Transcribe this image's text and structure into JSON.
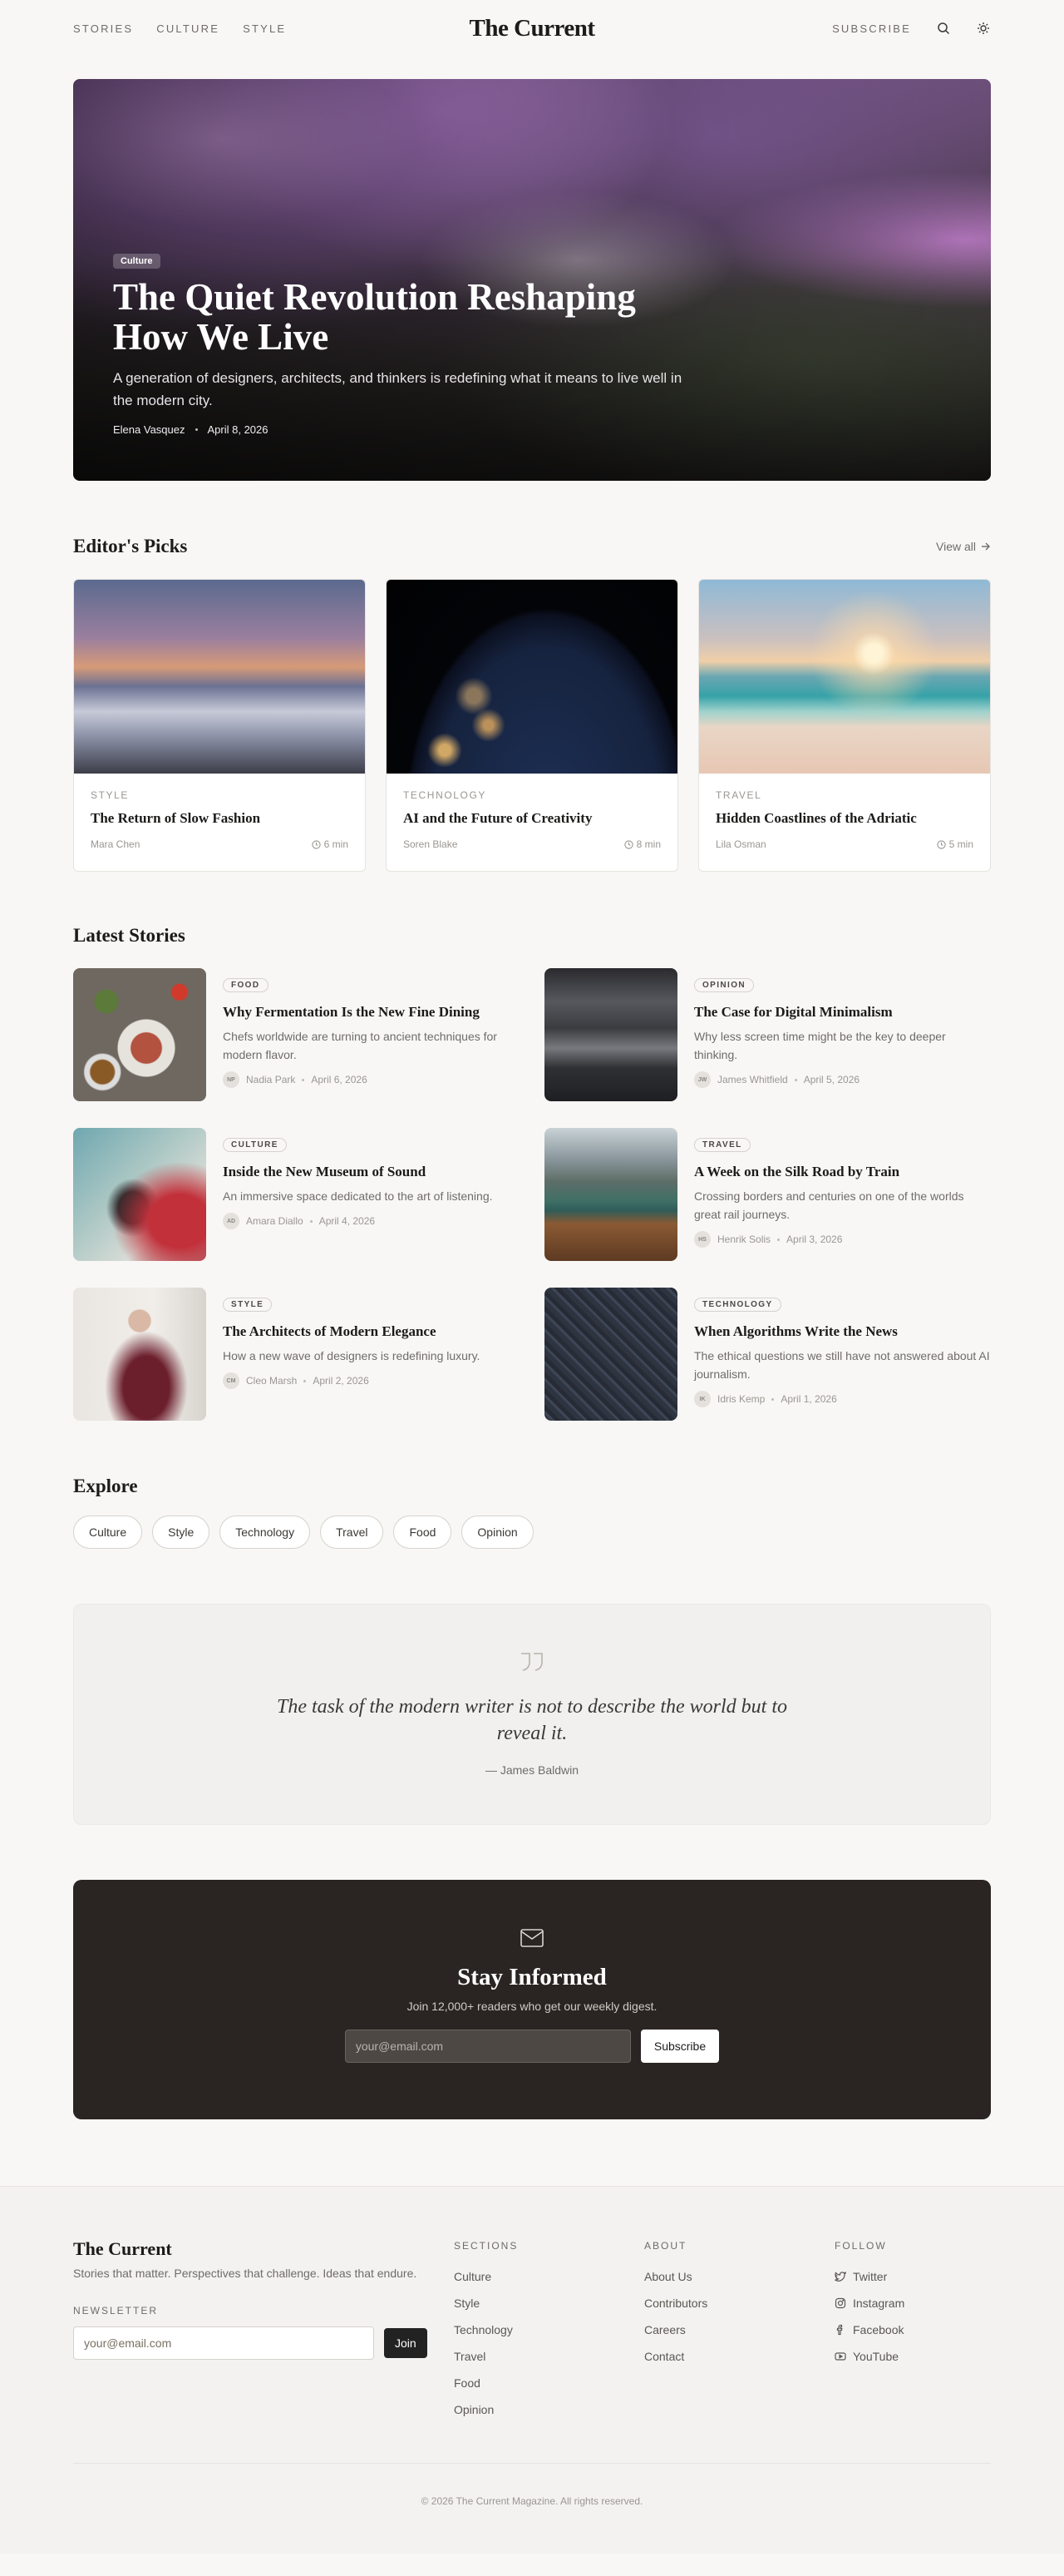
{
  "header": {
    "nav": [
      "STORIES",
      "CULTURE",
      "STYLE"
    ],
    "logo": "The Current",
    "subscribe": "SUBSCRIBE",
    "icons": [
      "search-icon",
      "sun-icon"
    ]
  },
  "hero": {
    "badge": "Culture",
    "title": "The Quiet Revolution Reshaping How We Live",
    "subtitle": "A generation of designers, architects, and thinkers is redefining what it means to live well in the modern city.",
    "author": "Elena Vasquez",
    "date": "April 8, 2026"
  },
  "picks": {
    "heading": "Editor's Picks",
    "view_all": "View all",
    "items": [
      {
        "category": "STYLE",
        "title": "The Return of Slow Fashion",
        "author": "Mara Chen",
        "read": "6 min"
      },
      {
        "category": "TECHNOLOGY",
        "title": "AI and the Future of Creativity",
        "author": "Soren Blake",
        "read": "8 min"
      },
      {
        "category": "TRAVEL",
        "title": "Hidden Coastlines of the Adriatic",
        "author": "Lila Osman",
        "read": "5 min"
      }
    ]
  },
  "latest": {
    "heading": "Latest Stories",
    "items": [
      {
        "tag": "FOOD",
        "title": "Why Fermentation Is the New Fine Dining",
        "excerpt": "Chefs worldwide are turning to ancient techniques for modern flavor.",
        "initials": "NP",
        "author": "Nadia Park",
        "date": "April 6, 2026"
      },
      {
        "tag": "OPINION",
        "title": "The Case for Digital Minimalism",
        "excerpt": "Why less screen time might be the key to deeper thinking.",
        "initials": "JW",
        "author": "James Whitfield",
        "date": "April 5, 2026"
      },
      {
        "tag": "CULTURE",
        "title": "Inside the New Museum of Sound",
        "excerpt": "An immersive space dedicated to the art of listening.",
        "initials": "AD",
        "author": "Amara Diallo",
        "date": "April 4, 2026"
      },
      {
        "tag": "TRAVEL",
        "title": "A Week on the Silk Road by Train",
        "excerpt": "Crossing borders and centuries on one of the worlds great rail journeys.",
        "initials": "HS",
        "author": "Henrik Solis",
        "date": "April 3, 2026"
      },
      {
        "tag": "STYLE",
        "title": "The Architects of Modern Elegance",
        "excerpt": "How a new wave of designers is redefining luxury.",
        "initials": "CM",
        "author": "Cleo Marsh",
        "date": "April 2, 2026"
      },
      {
        "tag": "TECHNOLOGY",
        "title": "When Algorithms Write the News",
        "excerpt": "The ethical questions we still have not answered about AI journalism.",
        "initials": "IK",
        "author": "Idris Kemp",
        "date": "April 1, 2026"
      }
    ]
  },
  "explore": {
    "heading": "Explore",
    "chips": [
      "Culture",
      "Style",
      "Technology",
      "Travel",
      "Food",
      "Opinion"
    ]
  },
  "quote": {
    "text": "The task of the modern writer is not to describe the world but to reveal it.",
    "by": "— James Baldwin"
  },
  "newsletter": {
    "title": "Stay Informed",
    "subtitle": "Join 12,000+ readers who get our weekly digest.",
    "placeholder": "your@email.com",
    "button": "Join",
    "button_alt": "Subscribe"
  },
  "footer": {
    "brand": "The Current",
    "tagline": "Stories that matter. Perspectives that challenge. Ideas that endure.",
    "newsletter_label": "NEWSLETTER",
    "placeholder": "your@email.com",
    "join": "Join",
    "sections_label": "SECTIONS",
    "sections": [
      "Culture",
      "Style",
      "Technology",
      "Travel",
      "Food",
      "Opinion"
    ],
    "about_label": "ABOUT",
    "about": [
      "About Us",
      "Contributors",
      "Careers",
      "Contact"
    ],
    "follow_label": "FOLLOW",
    "follow": [
      "Twitter",
      "Instagram",
      "Facebook",
      "YouTube"
    ],
    "copyright": "© 2026 The Current Magazine. All rights reserved."
  }
}
